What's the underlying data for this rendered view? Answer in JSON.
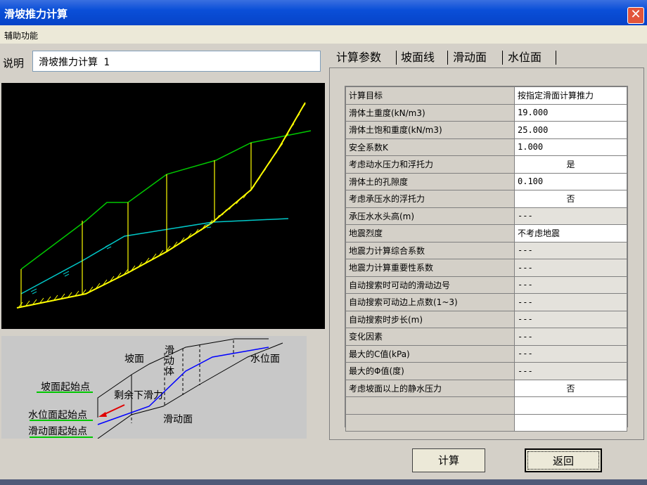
{
  "window": {
    "title": "滑坡推力计算",
    "close_glyph": "✕"
  },
  "menu": {
    "item": "辅助功能"
  },
  "description": {
    "label": "说明",
    "value": "滑坡推力计算 1"
  },
  "tabs": [
    {
      "label": "计算参数",
      "active": true
    },
    {
      "label": "坡面线",
      "active": false
    },
    {
      "label": "滑动面",
      "active": false
    },
    {
      "label": "水位面",
      "active": false
    }
  ],
  "params": [
    {
      "key": "计算目标",
      "value": "按指定滑面计算推力",
      "style": "text"
    },
    {
      "key": "滑体土重度(kN/m3)",
      "value": "19.000",
      "style": "num"
    },
    {
      "key": "滑体土饱和重度(kN/m3)",
      "value": "25.000",
      "style": "num"
    },
    {
      "key": "安全系数K",
      "value": "1.000",
      "style": "num"
    },
    {
      "key": "考虑动水压力和浮托力",
      "value": "是",
      "style": "center"
    },
    {
      "key": "滑体土的孔隙度",
      "value": "0.100",
      "style": "num"
    },
    {
      "key": "考虑承压水的浮托力",
      "value": "否",
      "style": "center"
    },
    {
      "key": "承压水水头高(m)",
      "value": "---",
      "style": "grey"
    },
    {
      "key": "地震烈度",
      "value": "不考虑地震",
      "style": "text"
    },
    {
      "key": "地震力计算综合系数",
      "value": "---",
      "style": "grey"
    },
    {
      "key": "地震力计算重要性系数",
      "value": "---",
      "style": "grey"
    },
    {
      "key": "自动搜索时可动的滑动边号",
      "value": "---",
      "style": "grey"
    },
    {
      "key": "自动搜索可动边上点数(1~3)",
      "value": "---",
      "style": "grey"
    },
    {
      "key": "自动搜索时步长(m)",
      "value": "---",
      "style": "grey"
    },
    {
      "key": "变化因素",
      "value": "---",
      "style": "grey"
    },
    {
      "key": "最大的C值(kPa)",
      "value": "---",
      "style": "grey"
    },
    {
      "key": "最大的Φ值(度)",
      "value": "---",
      "style": "grey"
    },
    {
      "key": "考虑坡面以上的静水压力",
      "value": "否",
      "style": "center"
    },
    {
      "key": "",
      "value": "",
      "style": "text"
    },
    {
      "key": "",
      "value": "",
      "style": "text"
    }
  ],
  "legend": {
    "slope": "坡面",
    "slide_body": "滑动体",
    "water_level": "水位面",
    "slope_start": "坡面起始点",
    "residual": "剩余下滑力",
    "water_start": "水位面起始点",
    "slide_start": "滑动面起始点",
    "slide_surface": "滑动面"
  },
  "buttons": {
    "calc": "计算",
    "back": "返回"
  },
  "colors": {
    "slope_line": "#00c800",
    "water_line": "#00c8c8",
    "slide_line": "#ffff00",
    "slices": "#ffff00"
  }
}
